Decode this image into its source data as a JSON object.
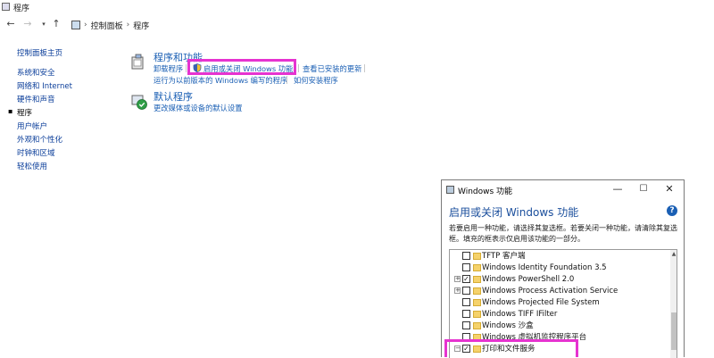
{
  "window": {
    "title": "程序"
  },
  "address": {
    "crumbs": [
      "控制面板",
      "程序"
    ]
  },
  "leftnav": {
    "home": "控制面板主页",
    "items": [
      "系统和安全",
      "网络和 Internet",
      "硬件和声音",
      "程序",
      "用户帐户",
      "外观和个性化",
      "时钟和区域",
      "轻松使用"
    ],
    "current_index": 3
  },
  "programs": {
    "title": "程序和功能",
    "links": [
      "卸载程序",
      "启用或关闭 Windows 功能",
      "查看已安装的更新",
      "运行为以前版本的 Windows 编写的程序",
      "如何安装程序"
    ]
  },
  "defaults": {
    "title": "默认程序",
    "links": [
      "更改媒体或设备的默认设置"
    ]
  },
  "dialog": {
    "title": "Windows 功能",
    "heading": "启用或关闭 Windows 功能",
    "help": "?",
    "description": "若要启用一种功能，请选择其复选框。若要关闭一种功能，请清除其复选框。填充的框表示仅启用该功能的一部分。",
    "features": [
      {
        "label": "TFTP 客户端",
        "checked": false,
        "expandable": false
      },
      {
        "label": "Windows Identity Foundation 3.5",
        "checked": false,
        "expandable": false
      },
      {
        "label": "Windows PowerShell 2.0",
        "checked": true,
        "expandable": true
      },
      {
        "label": "Windows Process Activation Service",
        "checked": false,
        "expandable": true
      },
      {
        "label": "Windows Projected File System",
        "checked": false,
        "expandable": false
      },
      {
        "label": "Windows TIFF IFilter",
        "checked": false,
        "expandable": false
      },
      {
        "label": "Windows 沙盒",
        "checked": false,
        "expandable": false
      },
      {
        "label": "Windows 虚拟机监控程序平台",
        "checked": false,
        "expandable": false
      },
      {
        "label": "打印和文件服务",
        "checked": true,
        "expandable": true,
        "expanded": true
      }
    ]
  },
  "colors": {
    "highlight": "#e633d0",
    "link": "#1a5fb4"
  }
}
